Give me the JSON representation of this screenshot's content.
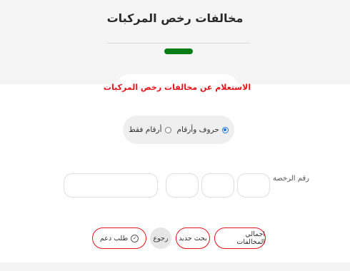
{
  "header": {
    "title": "مخالفات رخص المركبات"
  },
  "query": {
    "label": "الاستعلام عن مخالفات رخص المركبات"
  },
  "mode": {
    "options": [
      {
        "label": "حروف وأرقام",
        "checked": true
      },
      {
        "label": "أرقام فقط",
        "checked": false
      }
    ]
  },
  "plate": {
    "label": "رقم الرخصة"
  },
  "buttons": {
    "total": "اجمالي المخالفات",
    "new_search": "بحث جديد",
    "back": "رجوع",
    "support": "طلب دعم"
  },
  "colors": {
    "accent_red": "#e3131b",
    "accent_green": "#0a7d16",
    "radio_blue": "#1a73e8"
  }
}
